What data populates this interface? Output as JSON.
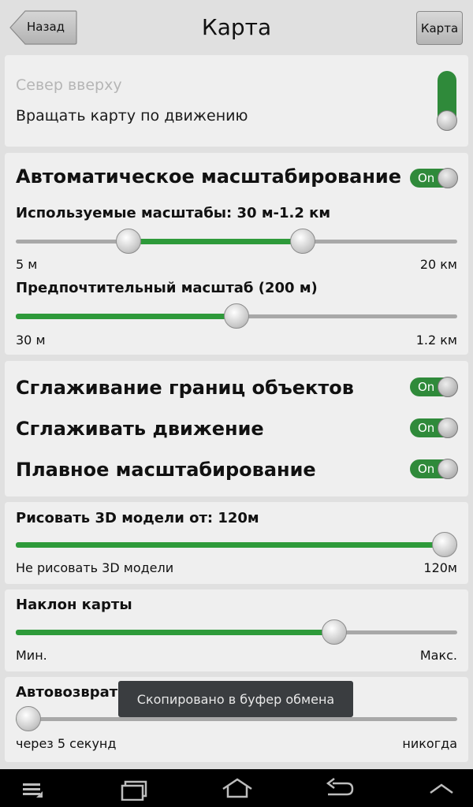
{
  "header": {
    "back_label": "Назад",
    "title": "Карта",
    "map_label": "Карта"
  },
  "orientation": {
    "north_up_label": "Север вверху",
    "rotate_label": "Вращать карту по движению",
    "rotate_enabled": true
  },
  "autoscale": {
    "title": "Автоматическое масштабирование",
    "toggle_text": "On",
    "used_scales_label": "Используемые масштабы: 30 м-1.2 км",
    "used_min_label": "5 м",
    "used_max_label": "20 км",
    "used_range": [
      0.24,
      0.66
    ],
    "preferred_label": "Предпочтительный масштаб (200 м)",
    "preferred_min_label": "30 м",
    "preferred_max_label": "1.2 км",
    "preferred_value": 0.5
  },
  "smoothing": {
    "items": [
      {
        "label": "Сглаживание границ объектов",
        "toggle_text": "On"
      },
      {
        "label": "Сглаживать движение",
        "toggle_text": "On"
      },
      {
        "label": "Плавное масштабирование",
        "toggle_text": "On"
      }
    ]
  },
  "models3d": {
    "label": "Рисовать 3D модели от: 120м",
    "min_label": "Не рисовать 3D модели",
    "max_label": "120м",
    "value": 1.0
  },
  "tilt": {
    "label": "Наклон карты",
    "min_label": "Мин.",
    "max_label": "Макс.",
    "value": 0.735
  },
  "autoreturn": {
    "label": "Автовозврат",
    "min_label": "через 5 секунд",
    "max_label": "никогда",
    "value": 0.0
  },
  "toast": {
    "text": "Скопировано в буфер обмена"
  },
  "navbar": {
    "icons": [
      "menu-icon",
      "recent-apps-icon",
      "home-icon",
      "back-icon",
      "chevron-up-icon"
    ]
  },
  "colors": {
    "accent": "#2e9a3a",
    "toggle": "#2f8a3a",
    "toast_bg": "#3a3d40"
  }
}
